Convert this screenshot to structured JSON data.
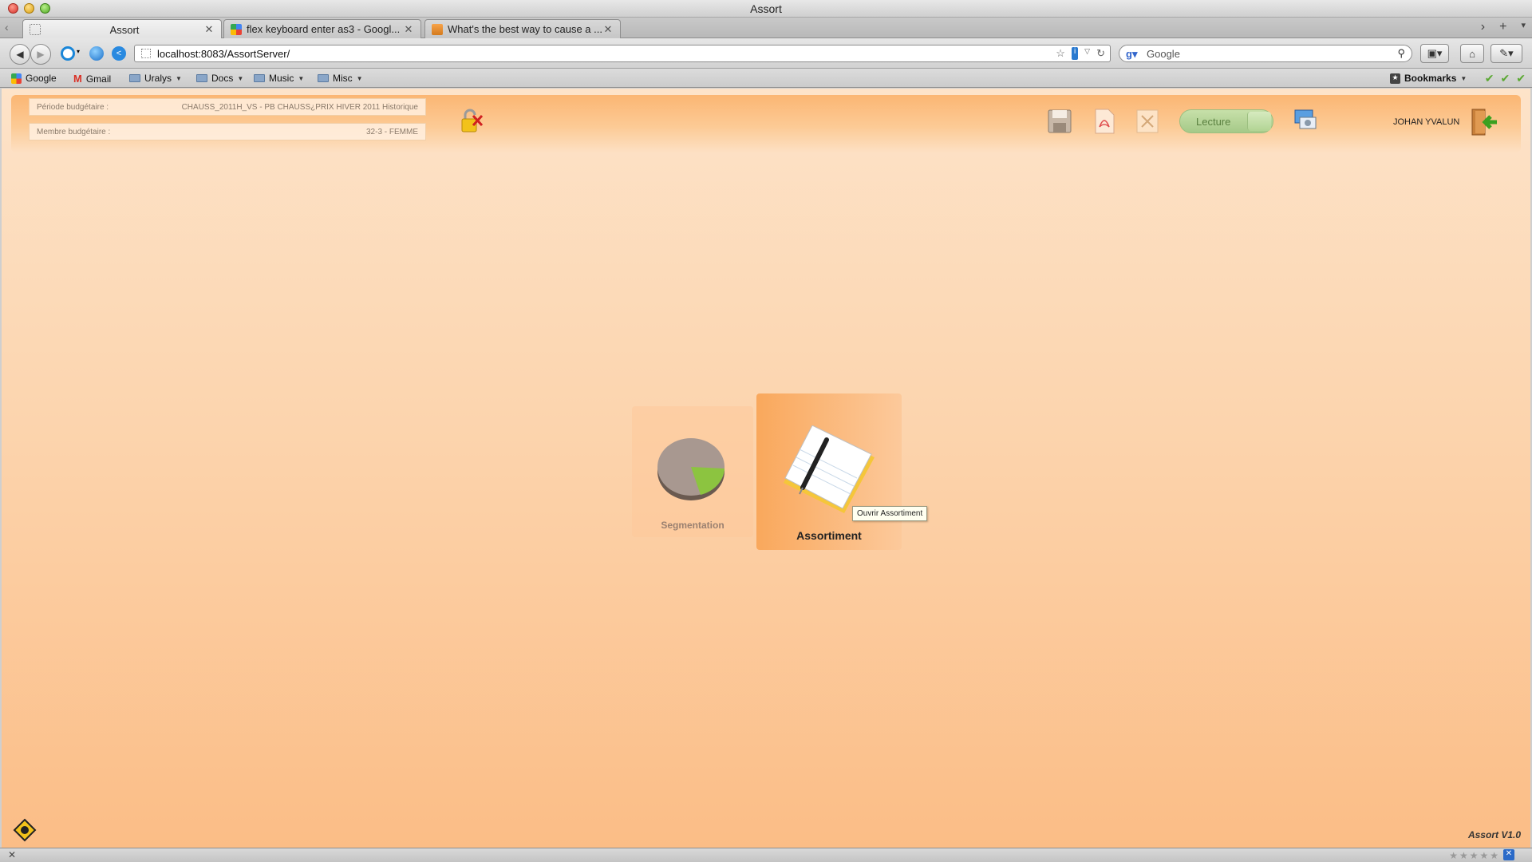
{
  "window": {
    "title": "Assort"
  },
  "tabs": [
    {
      "label": "Assort",
      "active": true
    },
    {
      "label": "flex keyboard enter as3 - Googl...",
      "active": false
    },
    {
      "label": "What's the best way to cause a ...",
      "active": false
    }
  ],
  "nav": {
    "url": "localhost:8083/AssortServer/",
    "search_placeholder": "Google"
  },
  "bookmarks": {
    "items": [
      {
        "label": "Google",
        "icon": "google-icon"
      },
      {
        "label": "Gmail",
        "icon": "gmail-icon"
      },
      {
        "label": "Uralys",
        "icon": "folder-icon",
        "menu": true
      },
      {
        "label": "Docs",
        "icon": "folder-icon",
        "menu": true
      },
      {
        "label": "Music",
        "icon": "folder-icon",
        "menu": true
      },
      {
        "label": "Misc",
        "icon": "folder-icon",
        "menu": true
      }
    ],
    "right_label": "Bookmarks"
  },
  "app": {
    "info": {
      "periode_label": "Période budgétaire :",
      "periode_value": "CHAUSS_2011H_VS - PB CHAUSS¿PRIX HIVER 2011 Historique",
      "membre_label": "Membre budgétaire :",
      "membre_value": "32-3 - FEMME"
    },
    "mode_toggle": "Lecture",
    "user_name": "JOHAN YVALUN",
    "modules": [
      {
        "label": "Segmentation",
        "icon": "pie-chart-icon",
        "active": false
      },
      {
        "label": "Assortiment",
        "icon": "notepad-pen-icon",
        "active": true
      }
    ],
    "tooltip": "Ouvrir Assortiment",
    "version": "Assort V1.0"
  },
  "colors": {
    "app_bg_top": "#fde3c9",
    "app_bg_bottom": "#fbbd86",
    "accent_orange": "#f9a85c",
    "toggle_green": "#a5c988"
  }
}
